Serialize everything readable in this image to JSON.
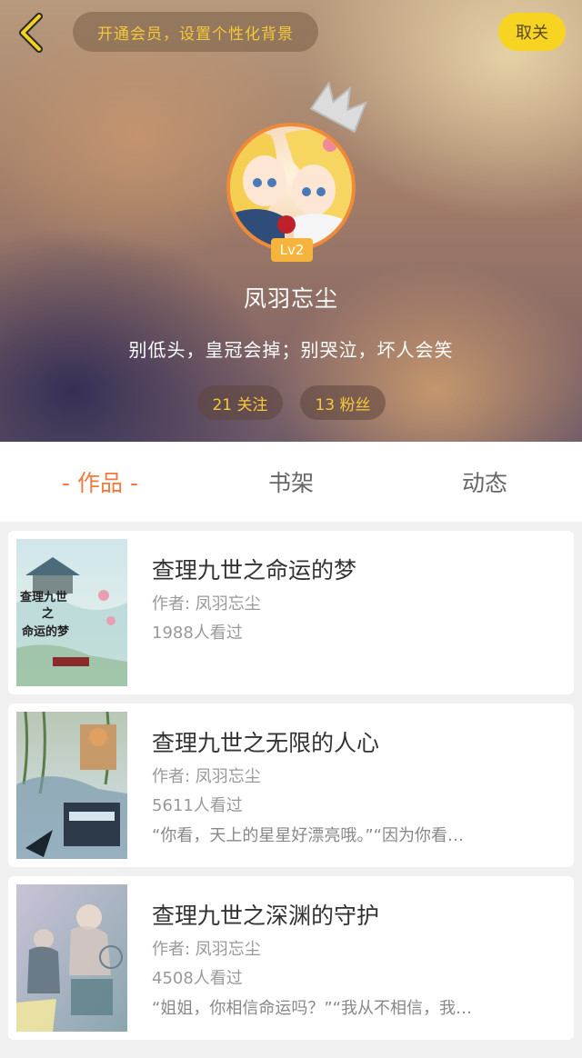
{
  "header": {
    "vip_banner": "开通会员，设置个性化背景",
    "unfollow_label": "取关",
    "level": "Lv2",
    "username": "凤羽忘尘",
    "signature": "别低头，皇冠会掉；别哭泣，坏人会笑",
    "following": "21 关注",
    "fans": "13 粉丝"
  },
  "tabs": [
    {
      "label": "- 作品 -",
      "active": true
    },
    {
      "label": "书架",
      "active": false
    },
    {
      "label": "动态",
      "active": false
    }
  ],
  "books": [
    {
      "title": "查理九世之命运的梦",
      "author": "作者: 凤羽忘尘",
      "views": "1988人看过",
      "excerpt": "",
      "cover_text": [
        "查理九世",
        "之",
        "命运的梦"
      ]
    },
    {
      "title": "查理九世之无限的人心",
      "author": "作者: 凤羽忘尘",
      "views": "5611人看过",
      "excerpt": "“你看，天上的星星好漂亮哦。”“因为你看…",
      "cover_text": []
    },
    {
      "title": "查理九世之深渊的守护",
      "author": "作者: 凤羽忘尘",
      "views": "4508人看过",
      "excerpt": "“姐姐，你相信命运吗？”“我从不相信，我…",
      "cover_text": []
    }
  ],
  "colors": {
    "accent": "#f07a3c",
    "vip_text": "#f5c93a",
    "unfollow_bg": "#f7d421",
    "level_bg": "#f5b43b"
  },
  "icons": [
    "back-arrow-icon",
    "crown-icon"
  ]
}
